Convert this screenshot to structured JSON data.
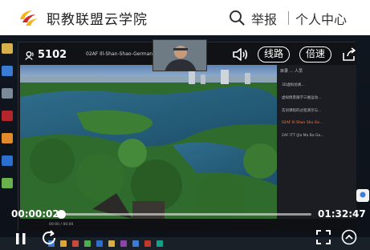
{
  "header": {
    "title": "职教联盟云学院",
    "report_label": "举报",
    "personal_label": "个人中心"
  },
  "player": {
    "viewer_count": "5102",
    "line_label": "线路",
    "speed_label": "倍速",
    "current_time": "00:00:02",
    "total_time": "01:32:47",
    "progress_fraction": 0.0004
  },
  "inner_window": {
    "title": "02AF Ill-Shan-Shao-German Dual Vo",
    "panel_tabs": "目录   ...   人员",
    "panel_items": [
      "3D虚拟仿真...",
      "虚拟情景跟学三维运动...",
      "实训课程的过程演示与...",
      "02AF Ill Shan Sho Ge...",
      "2AF ITT (Jla Ma Ba Ge..."
    ],
    "active_index": 3,
    "controls_text": "00:00 / 00:00"
  },
  "colors": {
    "accent_orange": "#ff7b39",
    "brand_yellow": "#f5b31a",
    "brand_red": "#d6282d"
  }
}
